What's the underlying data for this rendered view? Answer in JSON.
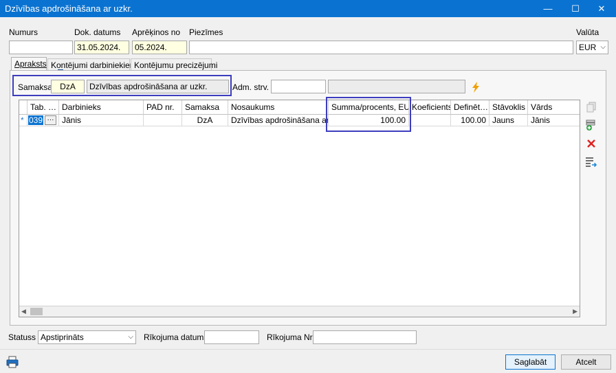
{
  "window": {
    "title": "Dzīvības apdrošināšana ar uzkr.",
    "minimize": "—",
    "maximize": "☐",
    "close": "✕"
  },
  "header": {
    "numurs_label": "Numurs",
    "numurs_value": "",
    "dok_datums_label": "Dok. datums",
    "dok_datums_value": "31.05.2024.",
    "aprekinos_label": "Aprēķinos no",
    "aprekinos_value": "05.2024.",
    "piezimes_label": "Piezīmes",
    "piezimes_value": "",
    "valuta_label": "Valūta",
    "valuta_value": "EUR"
  },
  "tabs": [
    {
      "label": "Apraksts"
    },
    {
      "label": "Kontējumi darbiniekiem"
    },
    {
      "label": "Kontējumu precizējumi"
    }
  ],
  "samaksa_row": {
    "label": "Samaksa",
    "code": "DzA",
    "name": "Dzīvības apdrošināšana ar uzkr.",
    "adm_label": "Adm. strv.",
    "adm_value": "",
    "adm_name": ""
  },
  "grid": {
    "columns": [
      "Tab. …",
      "Darbinieks",
      "PAD nr.",
      "Samaksa",
      "Nosaukums",
      "Summa/procents, EUR",
      "Koeficients",
      "Definēt…",
      "Stāvoklis",
      "Vārds"
    ],
    "rows": [
      {
        "marker": "*",
        "tab": "039",
        "ellipsis": "···",
        "darbinieks": "Jānis",
        "pad": "",
        "samaksa": "DzA",
        "nosaukums": "Dzīvības apdrošināšana ar …",
        "summa": "100.00",
        "koef": "",
        "definet": "100.00",
        "stavoklis": "Jauns",
        "vards": "Jānis"
      }
    ],
    "scroll_left": "◀",
    "scroll_right": "▶"
  },
  "footer": {
    "statuss_label": "Statuss",
    "statuss_value": "Apstiprināts",
    "rikojuma_datums_label": "Rīkojuma datums",
    "rikojuma_datums_value": "",
    "rikojuma_nr_label": "Rīkojuma Nr.",
    "rikojuma_nr_value": "",
    "save_label": "Saglabāt",
    "cancel_label": "Atcelt"
  },
  "colors": {
    "titlebar": "#0a73d1",
    "highlight": "#3c3cbe",
    "yellow_field": "#ffffe1",
    "delete": "#e02020",
    "lightning": "#f0a000"
  }
}
